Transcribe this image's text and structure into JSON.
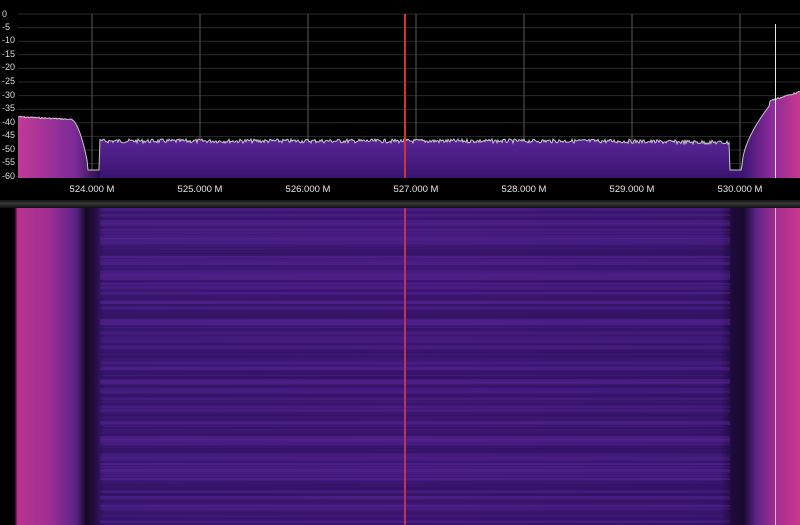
{
  "spectrum": {
    "db_scale": [
      "0",
      "-5",
      "-10",
      "-15",
      "-20",
      "-25",
      "-30",
      "-35",
      "-40",
      "-45",
      "-50",
      "-55",
      "-60"
    ],
    "freq_labels": [
      "524.000 M",
      "525.000 M",
      "526.000 M",
      "527.000 M",
      "528.000 M",
      "529.000 M",
      "530.000 M"
    ]
  },
  "colors": {
    "background": "#000000",
    "grid": "#5a5a5a",
    "fill_channel": "#4b1f86",
    "fill_edge": "#b8308f",
    "trace": "#c8c8c8",
    "tuning_marker": "#d03434",
    "waterfall_base": "#3e1a78"
  }
}
